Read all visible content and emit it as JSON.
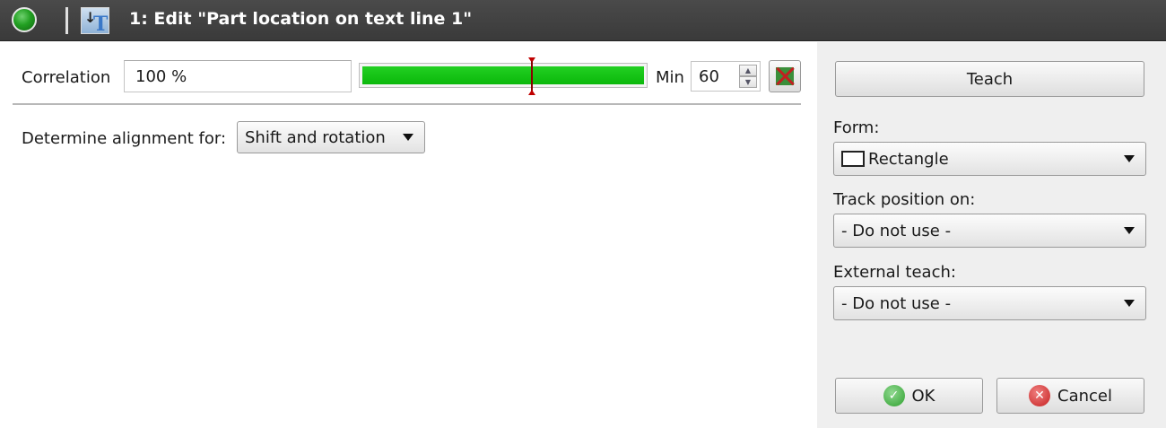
{
  "window": {
    "title": "1: Edit \"Part location on text line 1\"",
    "status_icon": "green-led-icon",
    "tool_icon": "text-tool-icon"
  },
  "correlation": {
    "label": "Correlation",
    "value": "100 %",
    "level_percent": 100,
    "min_label": "Min",
    "min_value": "60"
  },
  "alignment": {
    "label": "Determine alignment for:",
    "selected": "Shift and rotation"
  },
  "panel": {
    "teach_label": "Teach",
    "form_label": "Form:",
    "form_selected": "Rectangle",
    "track_label": "Track position on:",
    "track_selected": "- Do not use -",
    "external_label": "External teach:",
    "external_selected": "- Do not use -",
    "ok_label": "OK",
    "cancel_label": "Cancel"
  },
  "colors": {
    "titlebar": "#3f3f3f",
    "progress_fill": "#12c212",
    "panel_bg": "#efefef"
  }
}
